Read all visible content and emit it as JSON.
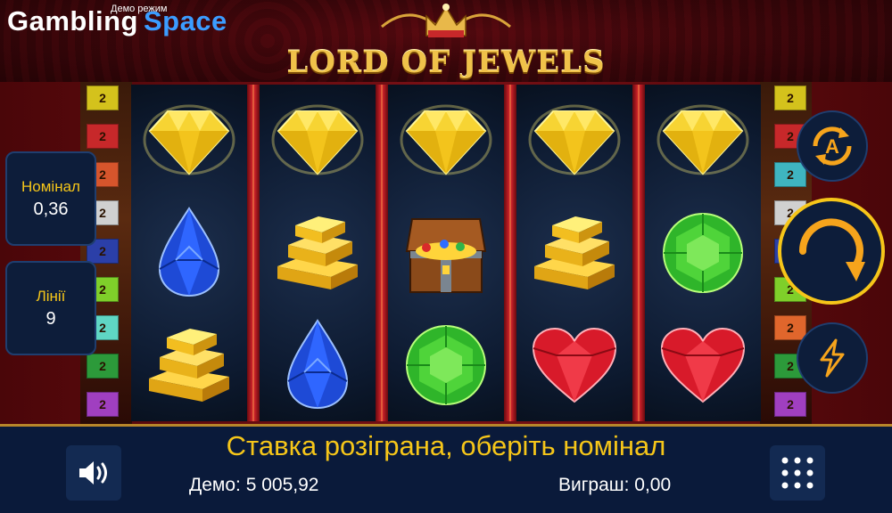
{
  "header": {
    "brand_part1": "Gambling",
    "brand_part2": "Space",
    "demo_mode": "Демо режим",
    "game_title": "LORD OF JEWELS"
  },
  "line_badges": {
    "left": [
      {
        "label": "2",
        "color": "#d4c21c"
      },
      {
        "label": "2",
        "color": "#c7282a"
      },
      {
        "label": "2",
        "color": "#d6552c"
      },
      {
        "label": "2",
        "color": "#d0d0d0"
      },
      {
        "label": "2",
        "color": "#2b3fa8"
      },
      {
        "label": "2",
        "color": "#7fcf2a"
      },
      {
        "label": "2",
        "color": "#5fd6c4"
      },
      {
        "label": "2",
        "color": "#2c9a3a"
      },
      {
        "label": "2",
        "color": "#a03fc0"
      }
    ],
    "right": [
      {
        "label": "2",
        "color": "#d4c21c"
      },
      {
        "label": "2",
        "color": "#c7282a"
      },
      {
        "label": "2",
        "color": "#3fb5c0"
      },
      {
        "label": "2",
        "color": "#d0d0d0"
      },
      {
        "label": "2",
        "color": "#2b3fa8"
      },
      {
        "label": "2",
        "color": "#7fcf2a"
      },
      {
        "label": "2",
        "color": "#e0662c"
      },
      {
        "label": "2",
        "color": "#2c9a3a"
      },
      {
        "label": "2",
        "color": "#a03fc0"
      }
    ]
  },
  "reels": [
    [
      "yellow-diamond",
      "blue-sapphire",
      "gold-bars"
    ],
    [
      "yellow-diamond",
      "gold-bars",
      "blue-sapphire"
    ],
    [
      "yellow-diamond",
      "treasure-chest",
      "green-emerald"
    ],
    [
      "yellow-diamond",
      "gold-bars",
      "red-heart-ruby"
    ],
    [
      "yellow-diamond",
      "green-emerald",
      "red-heart-ruby"
    ]
  ],
  "panels": {
    "denomination_label": "Номінал",
    "denomination_value": "0,36",
    "lines_label": "Лінії",
    "lines_value": "9"
  },
  "controls": {
    "autoplay_icon": "autoplay-icon",
    "spin_icon": "spin-icon",
    "turbo_icon": "lightning-icon",
    "sound_icon": "speaker-icon",
    "menu_icon": "grid-dots-icon",
    "accent": "#f6a41c"
  },
  "status": {
    "message": "Ставка розіграна, оберіть номінал",
    "demo_label": "Демо:",
    "demo_value": "5 005,92",
    "win_label": "Виграш:",
    "win_value": "0,00"
  }
}
